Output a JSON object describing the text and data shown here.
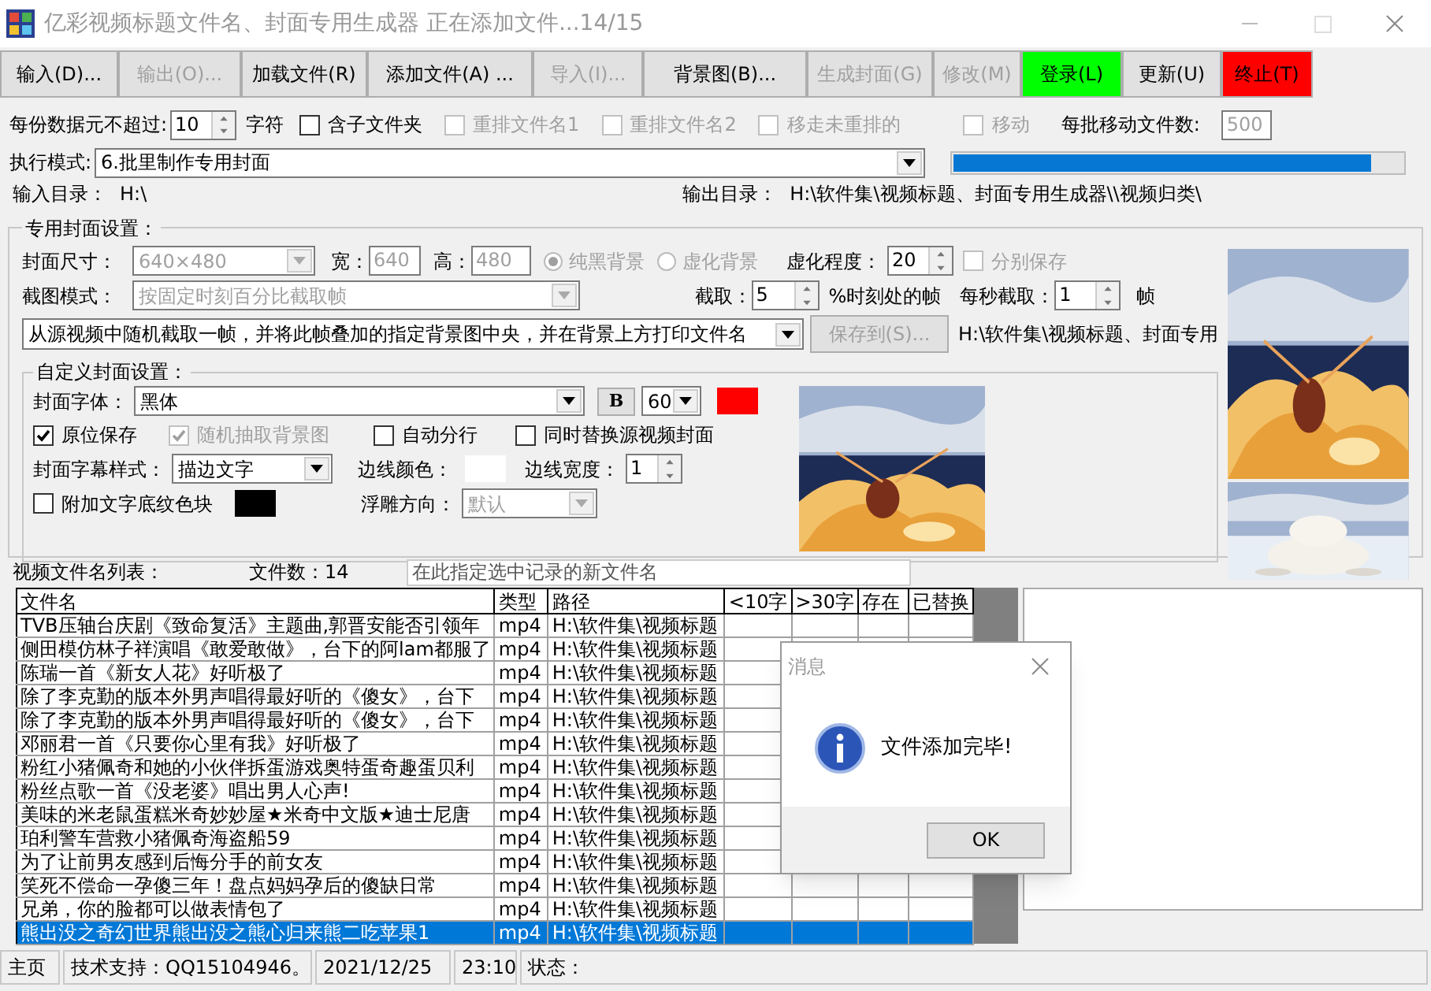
{
  "window": {
    "title": "亿彩视频标题文件名、封面专用生成器  正在添加文件...14/15"
  },
  "toolbar": [
    {
      "label": "输入(D)...",
      "disabled": false
    },
    {
      "label": "输出(O)...",
      "disabled": true
    },
    {
      "label": "加载文件(R)",
      "disabled": false
    },
    {
      "label": "添加文件(A) ...",
      "disabled": false
    },
    {
      "label": "导入(I)...",
      "disabled": true
    },
    {
      "label": "背景图(B)...",
      "disabled": false
    },
    {
      "label": "生成封面(G)",
      "disabled": true
    },
    {
      "label": "修改(M)",
      "disabled": true
    },
    {
      "label": "登录(L)",
      "disabled": false,
      "color": "#00ff00"
    },
    {
      "label": "更新(U)",
      "disabled": false
    },
    {
      "label": "终止(T)",
      "disabled": false,
      "color": "#ff0000"
    }
  ],
  "options": {
    "limit_label": "每份数据元不超过:",
    "limit_value": "10",
    "unit": "字符",
    "checkboxes": [
      {
        "label": "含子文件夹",
        "checked": false,
        "disabled": false
      },
      {
        "label": "重排文件名1",
        "checked": false,
        "disabled": true
      },
      {
        "label": "重排文件名2",
        "checked": false,
        "disabled": true
      },
      {
        "label": "移走未重排的",
        "checked": false,
        "disabled": true
      },
      {
        "label": "移动",
        "checked": false,
        "disabled": true
      }
    ],
    "batch_label": "每批移动文件数:",
    "batch_value": "500"
  },
  "mode": {
    "label": "执行模式:",
    "value": "6.批里制作专用封面",
    "progress": {
      "level": 0.93
    }
  },
  "dirs": {
    "input_label": "输入目录：",
    "input_value": "H:\\",
    "output_label": "输出目录：",
    "output_value": "H:\\软件集\\视频标题、封面专用生成器\\\\视频归类\\"
  },
  "cover": {
    "title": "专用封面设置：",
    "size_label": "封面尺寸：",
    "size_value": "640×480",
    "width_label": "宽：",
    "width_value": "640",
    "height_label": "高：",
    "height_value": "480",
    "radios": [
      {
        "label": "纯黑背景",
        "selected": true,
        "disabled": true
      },
      {
        "label": "虚化背景",
        "selected": false,
        "disabled": true
      }
    ],
    "blur_label": "虚化程度：",
    "blur_value": "20",
    "separate": {
      "label": "分别保存",
      "checked": false,
      "disabled": true
    },
    "capture_label": "截图模式：",
    "capture_value": "按固定时刻百分比截取帧",
    "take_label": "截取：",
    "take_value": "5",
    "percent_label": "%时刻处的帧",
    "per_second_label": "每秒截取：",
    "per_second_value": "1",
    "frame_label": "帧",
    "method_value": "从源视频中随机截取一帧，并将此帧叠加的指定背景图中央，并在背景上方打印文件名",
    "save_button": {
      "label": "保存到(S)...",
      "disabled": true
    },
    "save_path": "H:\\软件集\\视频标题、封面专用",
    "custom": {
      "title": "自定义封面设置：",
      "font_label": "封面字体：",
      "font_value": "黑体",
      "bold_label": "B",
      "size_value": "60",
      "text_color": {
        "color": "#ff0000"
      },
      "checkboxes": [
        {
          "label": "原位保存",
          "checked": true,
          "disabled": false
        },
        {
          "label": "随机抽取背景图",
          "checked": true,
          "disabled": true
        },
        {
          "label": "自动分行",
          "checked": false,
          "disabled": false
        },
        {
          "label": "同时替换源视频封面",
          "checked": false,
          "disabled": false
        }
      ],
      "style_label": "封面字幕样式：",
      "style_value": "描边文字",
      "border_color_label": "边线颜色：",
      "border_color": {
        "color": "#ffffff"
      },
      "border_width_label": "边线宽度：",
      "border_width_value": "1",
      "block": {
        "label": "附加文字底纹色块",
        "checked": false,
        "disabled": false
      },
      "block_color": {
        "color": "#000000"
      },
      "emboss_label": "浮雕方向：",
      "emboss_value": "默认"
    }
  },
  "list": {
    "label": "视频文件名列表：",
    "count": "文件数：14",
    "rename_placeholder": "在此指定选中记录的新文件名",
    "columns": [
      "文件名",
      "类型",
      "路径",
      "<10字",
      ">30字",
      "存在",
      "已替换"
    ],
    "rows": [
      {
        "cells": [
          "TVB压轴台庆剧《致命复活》主题曲,郭晋安能否引领年",
          "mp4",
          "H:\\软件集\\视频标题"
        ],
        "selected": false
      },
      {
        "cells": [
          "侧田模仿林子祥演唱《敢爱敢做》，台下的阿lam都服了",
          "mp4",
          "H:\\软件集\\视频标题"
        ],
        "selected": false
      },
      {
        "cells": [
          "陈瑞一首《新女人花》好听极了",
          "mp4",
          "H:\\软件集\\视频标题"
        ],
        "selected": false
      },
      {
        "cells": [
          "除了李克勤的版本外男声唱得最好听的《傻女》，台下",
          "mp4",
          "H:\\软件集\\视频标题"
        ],
        "selected": false
      },
      {
        "cells": [
          "除了李克勤的版本外男声唱得最好听的《傻女》，台下",
          "mp4",
          "H:\\软件集\\视频标题"
        ],
        "selected": false
      },
      {
        "cells": [
          "邓丽君一首《只要你心里有我》好听极了",
          "mp4",
          "H:\\软件集\\视频标题"
        ],
        "selected": false
      },
      {
        "cells": [
          "粉红小猪佩奇和她的小伙伴拆蛋游戏奥特蛋奇趣蛋贝利",
          "mp4",
          "H:\\软件集\\视频标题"
        ],
        "selected": false
      },
      {
        "cells": [
          "粉丝点歌一首《没老婆》唱出男人心声!",
          "mp4",
          "H:\\软件集\\视频标题"
        ],
        "selected": false
      },
      {
        "cells": [
          "美味的米老鼠蛋糕米奇妙妙屋★米奇中文版★迪士尼唐",
          "mp4",
          "H:\\软件集\\视频标题"
        ],
        "selected": false
      },
      {
        "cells": [
          "珀利警车营救小猪佩奇海盗船59",
          "mp4",
          "H:\\软件集\\视频标题"
        ],
        "selected": false
      },
      {
        "cells": [
          "为了让前男友感到后悔分手的前女友",
          "mp4",
          "H:\\软件集\\视频标题"
        ],
        "selected": false
      },
      {
        "cells": [
          "笑死不偿命一孕傻三年！盘点妈妈孕后的傻缺日常",
          "mp4",
          "H:\\软件集\\视频标题"
        ],
        "selected": false
      },
      {
        "cells": [
          "兄弟，你的脸都可以做表情包了",
          "mp4",
          "H:\\软件集\\视频标题"
        ],
        "selected": false
      },
      {
        "cells": [
          "熊出没之奇幻世界熊出没之熊心归来熊二吃苹果1",
          "mp4",
          "H:\\软件集\\视频标题"
        ],
        "selected": true
      }
    ]
  },
  "status_bar": [
    "主页",
    "技术支持：QQ15104946。",
    "2021/12/25",
    "23:10",
    "状态："
  ],
  "dialog": {
    "title": "消息",
    "message": "文件添加完毕!",
    "button": "OK"
  }
}
